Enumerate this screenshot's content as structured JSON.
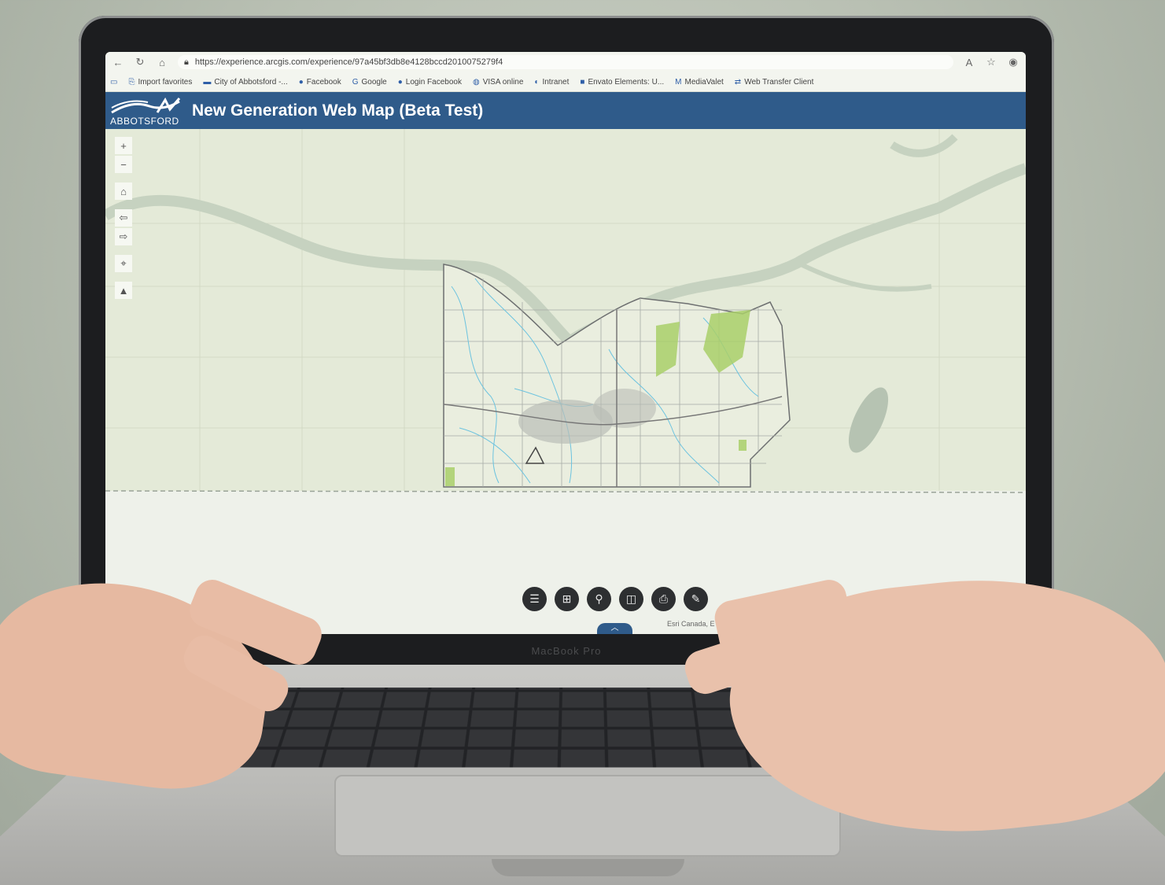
{
  "browser": {
    "url": "https://experience.arcgis.com/experience/97a45bf3db8e4128bccd2010075279f4",
    "bookmarks": [
      {
        "label": "Import favorites"
      },
      {
        "label": "City of Abbotsford -..."
      },
      {
        "label": "Facebook"
      },
      {
        "label": "Google"
      },
      {
        "label": "Login Facebook"
      },
      {
        "label": "VISA online"
      },
      {
        "label": "Intranet"
      },
      {
        "label": "Envato Elements: U..."
      },
      {
        "label": "MediaValet"
      },
      {
        "label": "Web Transfer Client"
      }
    ]
  },
  "app": {
    "logo_text": "ABBOTSFORD",
    "title": "New Generation Web Map (Beta Test)"
  },
  "map": {
    "controls": [
      "zoom-in",
      "zoom-out",
      "home",
      "previous-extent",
      "next-extent",
      "locate",
      "compass"
    ],
    "tools": [
      "layers",
      "basemap-gallery",
      "search",
      "measure",
      "print",
      "sketch"
    ],
    "attribution": "Esri Canada, E"
  },
  "device": {
    "brand": "MacBook Pro"
  },
  "colors": {
    "header": "#2f5b8a",
    "map_land": "#e4ead8",
    "river": "#c8d4c1",
    "streams": "#6cc3df",
    "parks": "#a9cf6a"
  }
}
